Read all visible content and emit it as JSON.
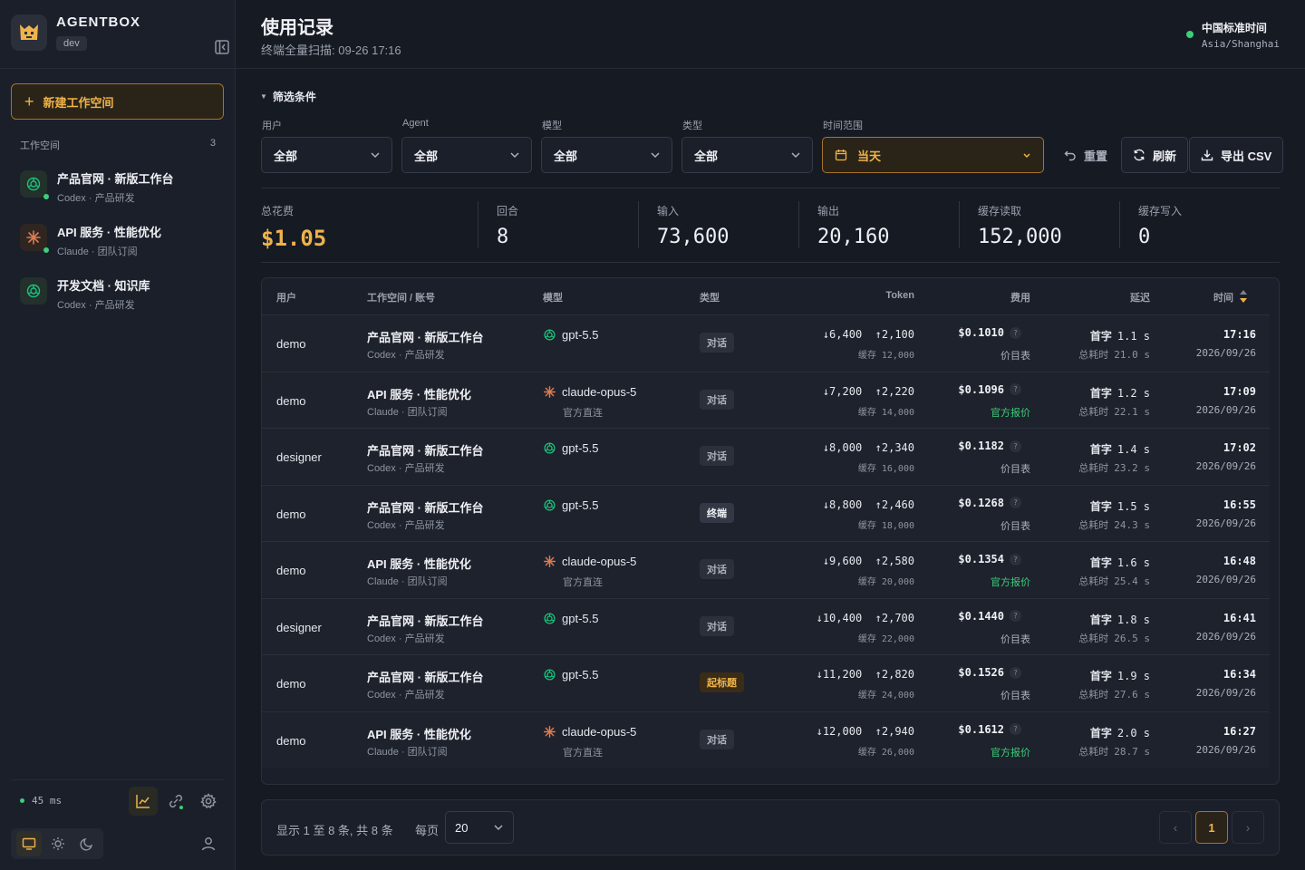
{
  "sidebar": {
    "brand_name": "AGENTBOX",
    "env": "dev",
    "new_workspace": "新建工作空间",
    "workspaces_label": "工作空间",
    "workspaces_count": "3",
    "workspaces": [
      {
        "title": "产品官网 · 新版工作台",
        "sub": "Codex · 产品研发",
        "agent": "codex"
      },
      {
        "title": "API 服务 · 性能优化",
        "sub": "Claude · 团队订阅",
        "agent": "claude"
      },
      {
        "title": "开发文档 · 知识库",
        "sub": "Codex · 产品研发",
        "agent": "codex"
      }
    ],
    "latency": "45 ms"
  },
  "header": {
    "title": "使用记录",
    "subtitle": "终端全量扫描: 09-26 17:16",
    "tz_name": "中国标准时间",
    "tz_zone": "Asia/Shanghai"
  },
  "filters": {
    "title": "筛选条件",
    "user_label": "用户",
    "user_value": "全部",
    "agent_label": "Agent",
    "agent_value": "全部",
    "model_label": "模型",
    "model_value": "全部",
    "type_label": "类型",
    "type_value": "全部",
    "time_label": "时间范围",
    "time_value": "当天",
    "reset": "重置",
    "refresh": "刷新",
    "export": "导出 CSV"
  },
  "stats": [
    {
      "label": "总花费",
      "value": "$1.05"
    },
    {
      "label": "回合",
      "value": "8"
    },
    {
      "label": "输入",
      "value": "73,600"
    },
    {
      "label": "输出",
      "value": "20,160"
    },
    {
      "label": "缓存读取",
      "value": "152,000"
    },
    {
      "label": "缓存写入",
      "value": "0"
    }
  ],
  "table": {
    "headers": {
      "user": "用户",
      "workspace": "工作空间 / 账号",
      "model": "模型",
      "type": "类型",
      "token": "Token",
      "fee": "费用",
      "latency": "延迟",
      "time": "时间"
    },
    "first_label": "首字",
    "total_label": "总耗时",
    "cache_label": "缓存",
    "rows": [
      {
        "user": "demo",
        "ws": "产品官网 · 新版工作台",
        "ws_sub": "Codex · 产品研发",
        "model": "gpt-5.5",
        "model_sub": "",
        "agent": "codex",
        "type": "对话",
        "type_kind": "chat",
        "in": "↓6,400",
        "out": "↑2,100",
        "cache": "12,000",
        "fee": "$0.1010",
        "fee_sub": "价目表",
        "fee_green": false,
        "first": "1.1 s",
        "total": "21.0 s",
        "time": "17:16",
        "date": "2026/09/26"
      },
      {
        "user": "demo",
        "ws": "API 服务 · 性能优化",
        "ws_sub": "Claude · 团队订阅",
        "model": "claude-opus-5",
        "model_sub": "官方直连",
        "agent": "claude",
        "type": "对话",
        "type_kind": "chat",
        "in": "↓7,200",
        "out": "↑2,220",
        "cache": "14,000",
        "fee": "$0.1096",
        "fee_sub": "官方报价",
        "fee_green": true,
        "first": "1.2 s",
        "total": "22.1 s",
        "time": "17:09",
        "date": "2026/09/26"
      },
      {
        "user": "designer",
        "ws": "产品官网 · 新版工作台",
        "ws_sub": "Codex · 产品研发",
        "model": "gpt-5.5",
        "model_sub": "",
        "agent": "codex",
        "type": "对话",
        "type_kind": "chat",
        "in": "↓8,000",
        "out": "↑2,340",
        "cache": "16,000",
        "fee": "$0.1182",
        "fee_sub": "价目表",
        "fee_green": false,
        "first": "1.4 s",
        "total": "23.2 s",
        "time": "17:02",
        "date": "2026/09/26"
      },
      {
        "user": "demo",
        "ws": "产品官网 · 新版工作台",
        "ws_sub": "Codex · 产品研发",
        "model": "gpt-5.5",
        "model_sub": "",
        "agent": "codex",
        "type": "终端",
        "type_kind": "term",
        "in": "↓8,800",
        "out": "↑2,460",
        "cache": "18,000",
        "fee": "$0.1268",
        "fee_sub": "价目表",
        "fee_green": false,
        "first": "1.5 s",
        "total": "24.3 s",
        "time": "16:55",
        "date": "2026/09/26"
      },
      {
        "user": "demo",
        "ws": "API 服务 · 性能优化",
        "ws_sub": "Claude · 团队订阅",
        "model": "claude-opus-5",
        "model_sub": "官方直连",
        "agent": "claude",
        "type": "对话",
        "type_kind": "chat",
        "in": "↓9,600",
        "out": "↑2,580",
        "cache": "20,000",
        "fee": "$0.1354",
        "fee_sub": "官方报价",
        "fee_green": true,
        "first": "1.6 s",
        "total": "25.4 s",
        "time": "16:48",
        "date": "2026/09/26"
      },
      {
        "user": "designer",
        "ws": "产品官网 · 新版工作台",
        "ws_sub": "Codex · 产品研发",
        "model": "gpt-5.5",
        "model_sub": "",
        "agent": "codex",
        "type": "对话",
        "type_kind": "chat",
        "in": "↓10,400",
        "out": "↑2,700",
        "cache": "22,000",
        "fee": "$0.1440",
        "fee_sub": "价目表",
        "fee_green": false,
        "first": "1.8 s",
        "total": "26.5 s",
        "time": "16:41",
        "date": "2026/09/26"
      },
      {
        "user": "demo",
        "ws": "产品官网 · 新版工作台",
        "ws_sub": "Codex · 产品研发",
        "model": "gpt-5.5",
        "model_sub": "",
        "agent": "codex",
        "type": "起标题",
        "type_kind": "title",
        "in": "↓11,200",
        "out": "↑2,820",
        "cache": "24,000",
        "fee": "$0.1526",
        "fee_sub": "价目表",
        "fee_green": false,
        "first": "1.9 s",
        "total": "27.6 s",
        "time": "16:34",
        "date": "2026/09/26"
      },
      {
        "user": "demo",
        "ws": "API 服务 · 性能优化",
        "ws_sub": "Claude · 团队订阅",
        "model": "claude-opus-5",
        "model_sub": "官方直连",
        "agent": "claude",
        "type": "对话",
        "type_kind": "chat",
        "in": "↓12,000",
        "out": "↑2,940",
        "cache": "26,000",
        "fee": "$0.1612",
        "fee_sub": "官方报价",
        "fee_green": true,
        "first": "2.0 s",
        "total": "28.7 s",
        "time": "16:27",
        "date": "2026/09/26"
      }
    ]
  },
  "pagination": {
    "info": "显示 1 至 8 条, 共 8 条",
    "per_page_label": "每页",
    "per_page": "20",
    "current": "1",
    "prev": "‹",
    "next": "›"
  },
  "colors": {
    "accent": "#f0b24a",
    "online": "#3ad07a",
    "bg": "#161a23"
  }
}
